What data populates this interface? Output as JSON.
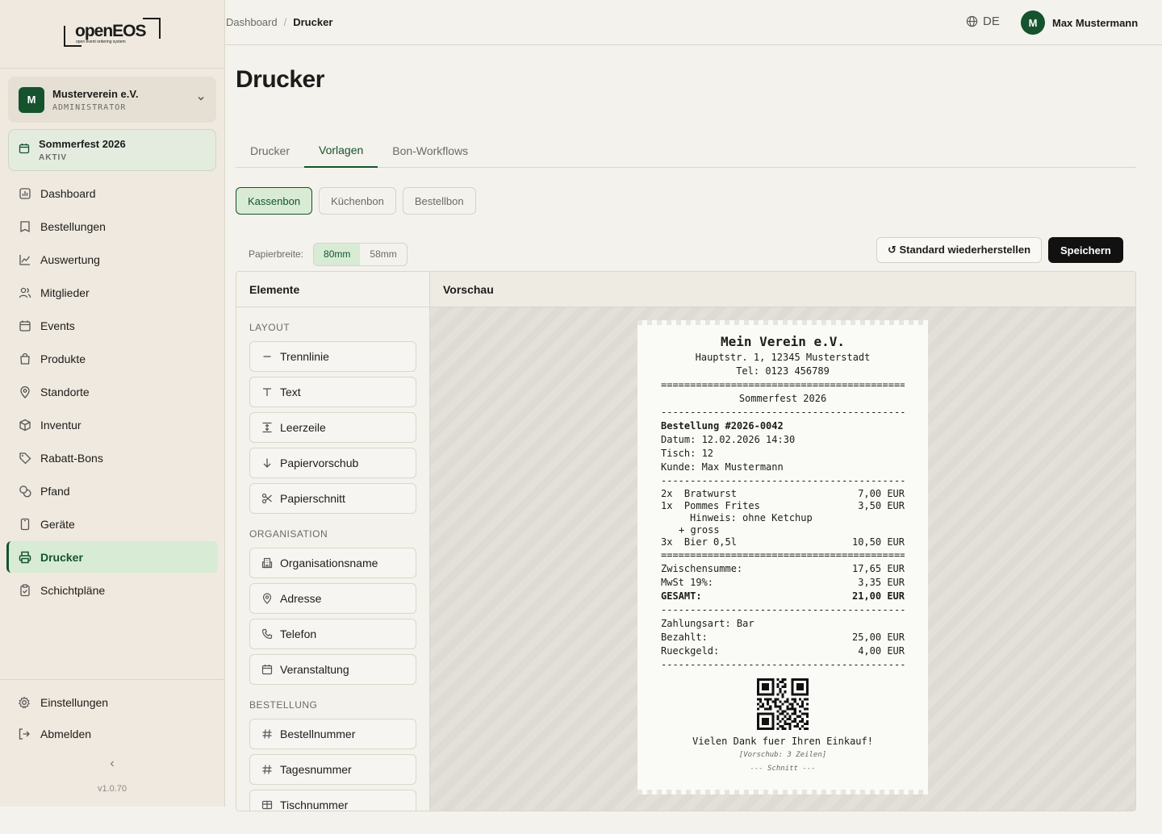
{
  "logo": {
    "word": "openEOS",
    "tagline": "open event ordering system"
  },
  "org": {
    "avatar": "M",
    "name": "Musterverein e.V.",
    "role": "ADMINISTRATOR"
  },
  "event": {
    "name": "Sommerfest 2026",
    "status": "AKTIV"
  },
  "nav": [
    {
      "label": "Dashboard",
      "icon": "chart-icon"
    },
    {
      "label": "Bestellungen",
      "icon": "receipt-icon"
    },
    {
      "label": "Auswertung",
      "icon": "trend-icon"
    },
    {
      "label": "Mitglieder",
      "icon": "users-icon"
    },
    {
      "label": "Events",
      "icon": "calendar-icon"
    },
    {
      "label": "Produkte",
      "icon": "bag-icon"
    },
    {
      "label": "Standorte",
      "icon": "pin-icon"
    },
    {
      "label": "Inventur",
      "icon": "box-icon"
    },
    {
      "label": "Rabatt-Bons",
      "icon": "tag-icon"
    },
    {
      "label": "Pfand",
      "icon": "coins-icon"
    },
    {
      "label": "Geräte",
      "icon": "tablet-icon"
    },
    {
      "label": "Drucker",
      "icon": "printer-icon",
      "active": true
    },
    {
      "label": "Schichtpläne",
      "icon": "clipboard-icon"
    }
  ],
  "sidebar_bottom": {
    "settings": "Einstellungen",
    "logout": "Abmelden",
    "collapse": "‹",
    "version": "v1.0.70"
  },
  "breadcrumb": {
    "root": "Dashboard",
    "sep": "/",
    "current": "Drucker"
  },
  "lang": "DE",
  "user": {
    "avatar": "M",
    "name": "Max Mustermann"
  },
  "page_title": "Drucker",
  "tabs": [
    "Drucker",
    "Vorlagen",
    "Bon-Workflows"
  ],
  "subtabs": [
    "Kassenbon",
    "Küchenbon",
    "Bestellbon"
  ],
  "toolbar": {
    "paper_label": "Papierbreite:",
    "w80": "80mm",
    "w58": "58mm",
    "reset": "↺ Standard wiederherstellen",
    "save": "Speichern"
  },
  "elements": {
    "title": "Elemente",
    "groups": [
      {
        "label": "LAYOUT",
        "items": [
          {
            "label": "Trennlinie",
            "icon": "minus-icon"
          },
          {
            "label": "Text",
            "icon": "text-icon"
          },
          {
            "label": "Leerzeile",
            "icon": "spacing-icon"
          },
          {
            "label": "Papiervorschub",
            "icon": "arrow-down-icon"
          },
          {
            "label": "Papierschnitt",
            "icon": "scissors-icon"
          }
        ]
      },
      {
        "label": "ORGANISATION",
        "items": [
          {
            "label": "Organisationsname",
            "icon": "building-icon"
          },
          {
            "label": "Adresse",
            "icon": "pin-icon"
          },
          {
            "label": "Telefon",
            "icon": "phone-icon"
          },
          {
            "label": "Veranstaltung",
            "icon": "calendar-icon"
          }
        ]
      },
      {
        "label": "BESTELLUNG",
        "items": [
          {
            "label": "Bestellnummer",
            "icon": "hash-icon"
          },
          {
            "label": "Tagesnummer",
            "icon": "hash-icon"
          },
          {
            "label": "Tischnummer",
            "icon": "table-icon"
          }
        ]
      }
    ]
  },
  "preview": {
    "title": "Vorschau",
    "org_name": "Mein Verein e.V.",
    "address": "Hauptstr. 1, 12345 Musterstadt",
    "phone": "Tel: 0123 456789",
    "double_sep": "==========================================",
    "single_sep": "------------------------------------------",
    "event": "Sommerfest 2026",
    "order": "Bestellung #2026-0042",
    "date": "Datum: 12.02.2026 14:30",
    "table": "Tisch: 12",
    "customer": "Kunde: Max Mustermann",
    "items": [
      {
        "qty": "2x  Bratwurst",
        "price": "7,00 EUR"
      },
      {
        "qty": "1x  Pommes Frites",
        "price": "3,50 EUR"
      },
      {
        "qty": "3x  Bier 0,5l",
        "price": "10,50 EUR"
      }
    ],
    "note": "Hinweis: ohne Ketchup",
    "modifier": "+ gross",
    "subtotal_label": "Zwischensumme:",
    "subtotal": "17,65 EUR",
    "tax_label": "MwSt 19%:",
    "tax": "3,35 EUR",
    "total_label": "GESAMT:",
    "total": "21,00 EUR",
    "payment": "Zahlungsart: Bar",
    "paid_label": "Bezahlt:",
    "paid": "25,00 EUR",
    "change_label": "Rueckgeld:",
    "change": "4,00 EUR",
    "thanks": "Vielen Dank fuer Ihren Einkauf!",
    "feed": "[Vorschub: 3 Zeilen]",
    "cut": "--- Schnitt ---"
  }
}
